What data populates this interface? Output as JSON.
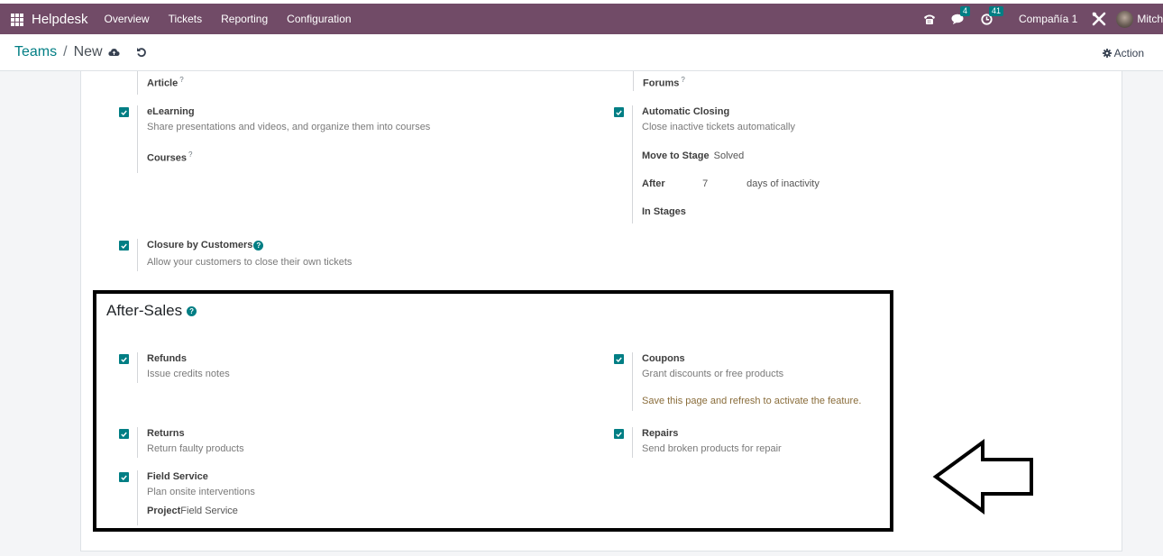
{
  "navbar": {
    "app_name": "Helpdesk",
    "menus": [
      "Overview",
      "Tickets",
      "Reporting",
      "Configuration"
    ],
    "icons": [
      "phone-icon",
      "chat-icon",
      "clock-activity-icon",
      "debug-tools-icon"
    ],
    "messages_badge": "4",
    "activities_badge": "41",
    "company": "Compañía 1",
    "user": "Mitch",
    "color": "#714b67"
  },
  "control_panel": {
    "breadcrumb_parent": "Teams",
    "breadcrumb_separator": "/",
    "breadcrumb_current": "New",
    "action_label": "Action"
  },
  "settings_top": {
    "article": {
      "label": "Article",
      "tooltip": "?"
    },
    "forums": {
      "label": "Forums",
      "tooltip": "?"
    },
    "elearning": {
      "label": "eLearning",
      "description": "Share presentations and videos, and organize them into courses",
      "checked": true,
      "subfield_label": "Courses",
      "subfield_tooltip": "?"
    },
    "automatic_closing": {
      "label": "Automatic Closing",
      "description": "Close inactive tickets automatically",
      "checked": true,
      "move_to_stage_label": "Move to Stage",
      "move_to_stage_value": "Solved",
      "after_label": "After",
      "after_value": "7",
      "after_suffix": "days of inactivity",
      "in_stages_label": "In Stages"
    },
    "closure_by_customers": {
      "label": "Closure by Customers",
      "description": "Allow your customers to close their own tickets",
      "checked": true
    }
  },
  "after_sales": {
    "title": "After-Sales",
    "refunds": {
      "label": "Refunds",
      "description": "Issue credits notes",
      "checked": true
    },
    "coupons": {
      "label": "Coupons",
      "description": "Grant discounts or free products",
      "warning": "Save this page and refresh to activate the feature.",
      "checked": true
    },
    "returns": {
      "label": "Returns",
      "description": "Return faulty products",
      "checked": true
    },
    "repairs": {
      "label": "Repairs",
      "description": "Send broken products for repair",
      "checked": true
    },
    "field_service": {
      "label": "Field Service",
      "description": "Plan onsite interventions",
      "checked": true,
      "project_label": "Project",
      "project_value": "Field Service"
    }
  },
  "colors": {
    "accent": "#017e84",
    "navbar": "#714b67",
    "warning_text": "#8a6d3b"
  }
}
